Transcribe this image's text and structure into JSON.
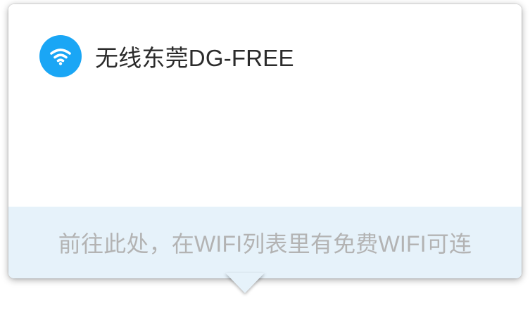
{
  "network": {
    "name": "无线东莞DG-FREE",
    "icon": "wifi-icon",
    "icon_color": "#1aa6f5"
  },
  "hint": {
    "text": "前往此处，在WIFI列表里有免费WIFI可连",
    "background": "#e6f2fa",
    "color": "#b3b3b3"
  }
}
